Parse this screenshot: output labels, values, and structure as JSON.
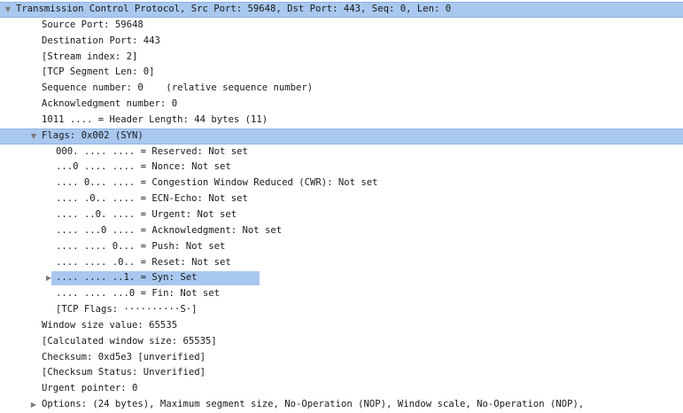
{
  "tcp": {
    "header": "Transmission Control Protocol, Src Port: 59648, Dst Port: 443, Seq: 0, Len: 0",
    "source_port": "Source Port: 59648",
    "destination_port": "Destination Port: 443",
    "stream_index": "[Stream index: 2]",
    "segment_len": "[TCP Segment Len: 0]",
    "sequence_number": "Sequence number: 0    (relative sequence number)",
    "ack_number": "Acknowledgment number: 0",
    "header_length": "1011 .... = Header Length: 44 bytes (11)",
    "flags": {
      "label": "Flags: 0x002 (SYN)",
      "items": [
        "000. .... .... = Reserved: Not set",
        "...0 .... .... = Nonce: Not set",
        ".... 0... .... = Congestion Window Reduced (CWR): Not set",
        ".... .0.. .... = ECN-Echo: Not set",
        ".... ..0. .... = Urgent: Not set",
        ".... ...0 .... = Acknowledgment: Not set",
        ".... .... 0... = Push: Not set",
        ".... .... .0.. = Reset: Not set",
        ".... .... ..1. = Syn: Set",
        ".... .... ...0 = Fin: Not set",
        "[TCP Flags: ··········S·]"
      ]
    },
    "window_size": "Window size value: 65535",
    "calc_window_size": "[Calculated window size: 65535]",
    "checksum": "Checksum: 0xd5e3 [unverified]",
    "checksum_status": "[Checksum Status: Unverified]",
    "urgent_pointer": "Urgent pointer: 0",
    "options": "Options: (24 bytes), Maximum segment size, No-Operation (NOP), Window scale, No-Operation (NOP),"
  },
  "icons": {
    "expanded": "▼",
    "collapsed": "▶"
  },
  "colors": {
    "selection": "#a9c8ef",
    "text": "#1a1a1a"
  }
}
